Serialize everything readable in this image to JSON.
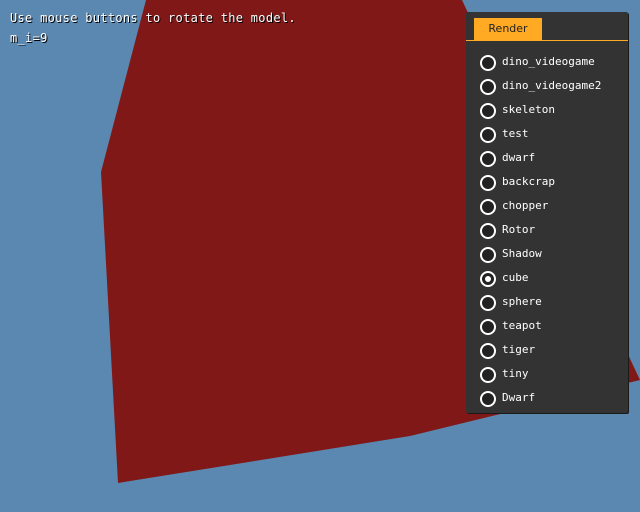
{
  "scene": {
    "background_color": "#5b88b1",
    "model_color": "#801818"
  },
  "overlay": {
    "help_text": "Use mouse buttons to rotate the model.",
    "debug_text": "m_i=9"
  },
  "panel": {
    "tab_label": "Render",
    "accent_color": "#ffaa22",
    "options": [
      {
        "label": "dino_videogame",
        "selected": false
      },
      {
        "label": "dino_videogame2",
        "selected": false
      },
      {
        "label": "skeleton",
        "selected": false
      },
      {
        "label": "test",
        "selected": false
      },
      {
        "label": "dwarf",
        "selected": false
      },
      {
        "label": "backcrap",
        "selected": false
      },
      {
        "label": "chopper",
        "selected": false
      },
      {
        "label": "Rotor",
        "selected": false
      },
      {
        "label": "Shadow",
        "selected": false
      },
      {
        "label": "cube",
        "selected": true
      },
      {
        "label": "sphere",
        "selected": false
      },
      {
        "label": "teapot",
        "selected": false
      },
      {
        "label": "tiger",
        "selected": false
      },
      {
        "label": "tiny",
        "selected": false
      },
      {
        "label": "Dwarf",
        "selected": false
      }
    ]
  }
}
